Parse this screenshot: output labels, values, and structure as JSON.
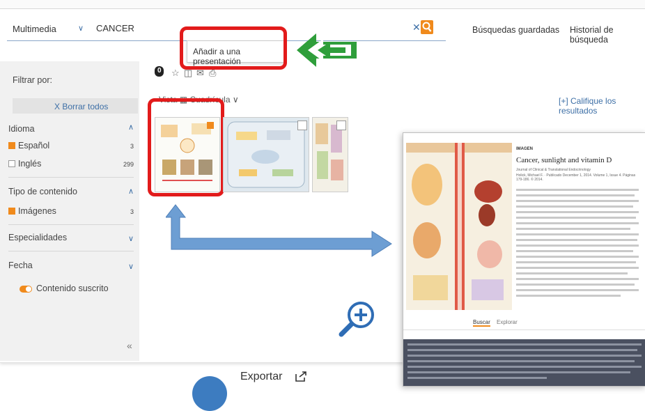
{
  "search": {
    "category": "Multimedia",
    "query": "CANCER",
    "clear_icon": "close-icon",
    "search_icon": "search-icon"
  },
  "topnav": {
    "saved": "Búsquedas guardadas",
    "history": "Historial de búsqueda"
  },
  "popup": {
    "add_to_presentation": "Añadir a una presentación"
  },
  "sidebar": {
    "filter_by": "Filtrar por:",
    "clear_all": "X Borrar todos",
    "language": {
      "title": "Idioma",
      "items": [
        {
          "label": "Español",
          "count": "3",
          "checked": true
        },
        {
          "label": "Inglés",
          "count": "299",
          "checked": false
        }
      ]
    },
    "content_type": {
      "title": "Tipo de contenido",
      "items": [
        {
          "label": "Imágenes",
          "count": "3",
          "checked": true
        }
      ]
    },
    "specialties": "Especialidades",
    "date": "Fecha",
    "subscribed": "Contenido suscrito",
    "collapse": "«"
  },
  "results": {
    "view_label": "Vista",
    "view_mode": "Cuadrícula",
    "rate_results": "[+] Califique los resultados"
  },
  "detail": {
    "type": "IMAGEN",
    "title": "Cancer, sunlight and vitamin D",
    "journal": "Journal of Clinical & Translational Endocrinology",
    "authors": "Holick, Michael F. · Publicado December 1, 2014. Volume 1, Issue 4. Páginas 179-186. © 2014.",
    "tab_search": "Buscar",
    "tab_explore": "Explorar"
  },
  "footer": {
    "export": "Exportar"
  },
  "colors": {
    "accent_orange": "#f08a1c",
    "link_blue": "#3d6fa6",
    "highlight_red": "#e21b1b",
    "arrow_blue": "#6d9ed3",
    "green_arrow": "#2f9e3b"
  }
}
